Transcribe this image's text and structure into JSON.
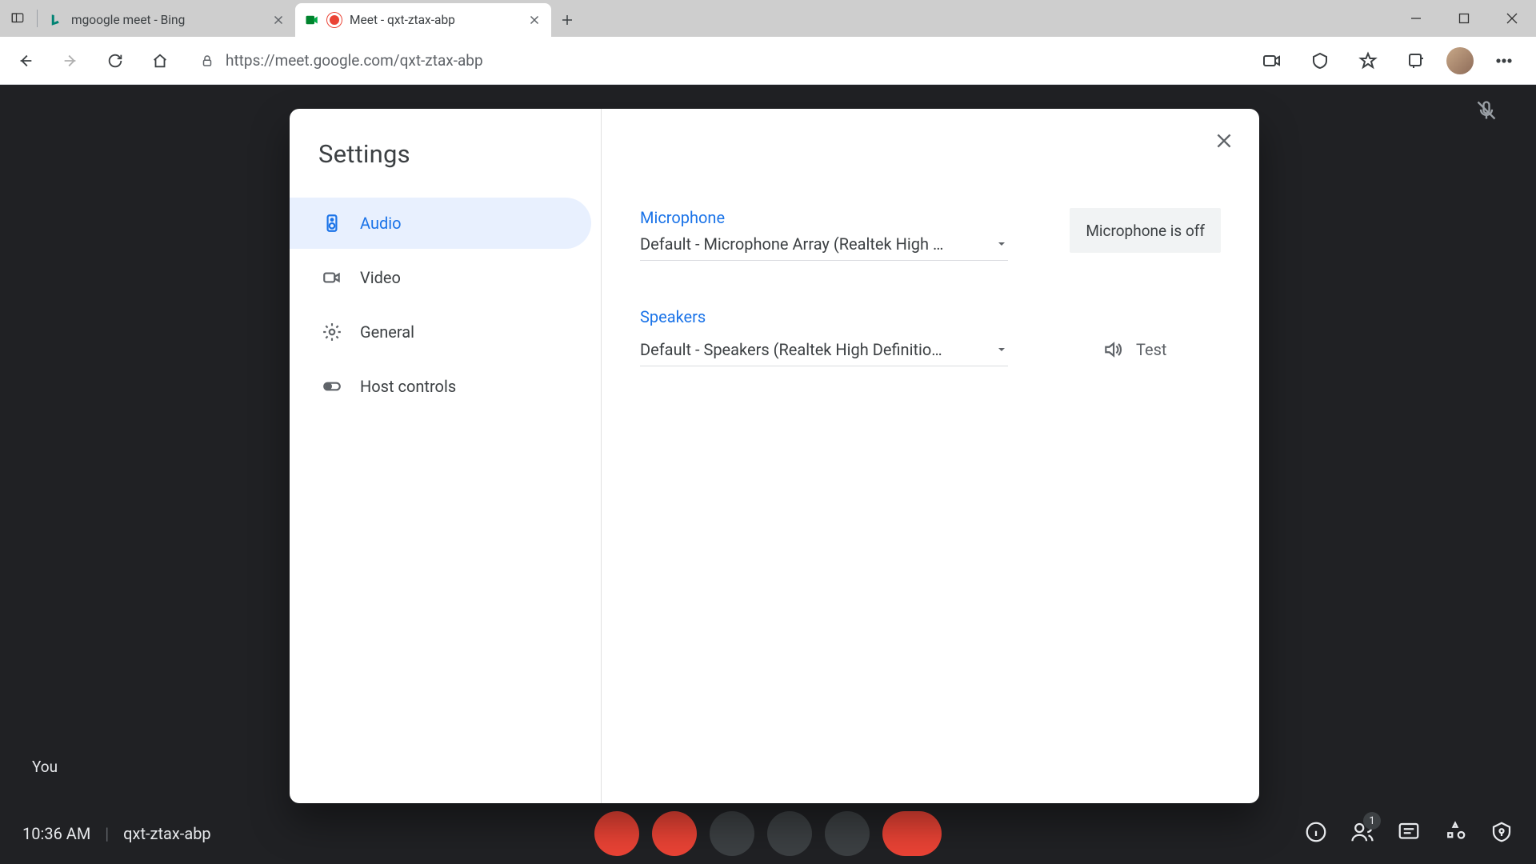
{
  "browser": {
    "tabs": [
      {
        "label": "mgoogle meet - Bing"
      },
      {
        "label": "Meet - qxt-ztax-abp"
      }
    ],
    "url": "https://meet.google.com/qxt-ztax-abp"
  },
  "meet": {
    "you": "You",
    "time": "10:36 AM",
    "code": "qxt-ztax-abp",
    "people_count": "1"
  },
  "dialog": {
    "title": "Settings",
    "nav": [
      {
        "label": "Audio"
      },
      {
        "label": "Video"
      },
      {
        "label": "General"
      },
      {
        "label": "Host controls"
      }
    ],
    "mic": {
      "label": "Microphone",
      "value": "Default - Microphone Array (Realtek High …",
      "status": "Microphone is off"
    },
    "spk": {
      "label": "Speakers",
      "value": "Default - Speakers (Realtek High Definitio…",
      "test": "Test"
    }
  }
}
